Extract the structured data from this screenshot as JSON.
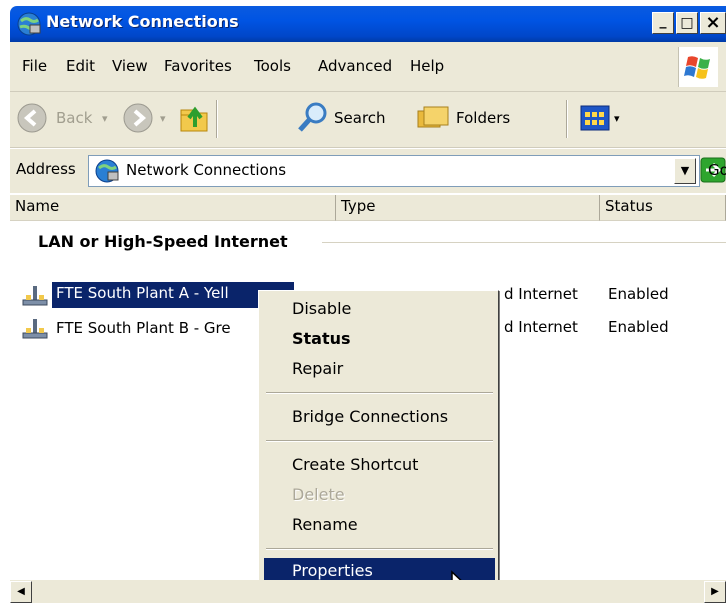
{
  "window": {
    "title": "Network Connections",
    "min_glyph": "_",
    "max_glyph": "□",
    "close_glyph": "×"
  },
  "menu": [
    "File",
    "Edit",
    "View",
    "Favorites",
    "Tools",
    "Advanced",
    "Help"
  ],
  "toolbar": {
    "back_label": "Back",
    "search_label": "Search",
    "folders_label": "Folders"
  },
  "address": {
    "label": "Address",
    "value": "Network Connections",
    "go_label": "Go"
  },
  "columns": [
    "Name",
    "Type",
    "Status"
  ],
  "group": {
    "header": "LAN or High-Speed Internet"
  },
  "connections": [
    {
      "name": "FTE South Plant A - Yell",
      "type": "d Internet",
      "status": "Enabled",
      "selected": true
    },
    {
      "name": "FTE South Plant B - Gre",
      "type": "d Internet",
      "status": "Enabled",
      "selected": false
    }
  ],
  "context_menu": {
    "items": [
      "Disable",
      "Status",
      "Repair",
      "Bridge Connections",
      "Create Shortcut",
      "Delete",
      "Rename",
      "Properties"
    ],
    "default_item": "Status",
    "disabled_item": "Delete",
    "highlighted_item": "Properties"
  },
  "colors": {
    "titlebar": "#0054e3",
    "selection": "#0a246a",
    "chrome": "#ece9d8"
  }
}
